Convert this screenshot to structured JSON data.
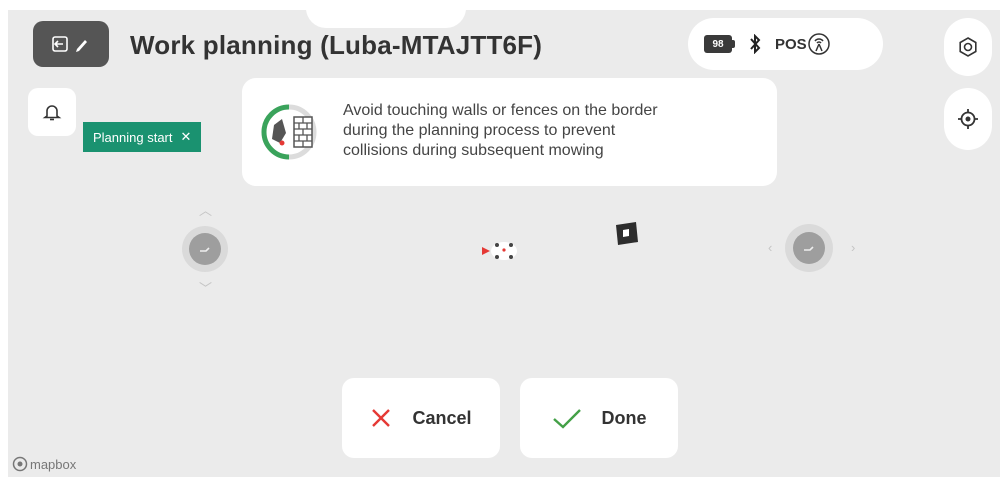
{
  "header": {
    "title": "Work planning (Luba-MTAJTT6F)",
    "back_icon": "exit-edit-icon"
  },
  "status": {
    "battery": "98",
    "bluetooth_icon": "bluetooth-icon",
    "pos_label": "POS",
    "signal_icon": "rtk-signal-icon"
  },
  "side_buttons": {
    "settings_icon": "gear-icon",
    "locate_icon": "locate-target-icon"
  },
  "notification": {
    "bell_icon": "bell-icon",
    "chip_label": "Planning start",
    "chip_close": "✕"
  },
  "tip": {
    "lines": [
      "Avoid touching walls or fences on the border",
      "during the planning process to prevent",
      "collisions during subsequent mowing"
    ]
  },
  "actions": {
    "cancel_label": "Cancel",
    "done_label": "Done"
  },
  "map": {
    "attribution": "mapbox"
  },
  "colors": {
    "accent": "#1a9270",
    "cancel": "#e53935",
    "done": "#43a047"
  }
}
